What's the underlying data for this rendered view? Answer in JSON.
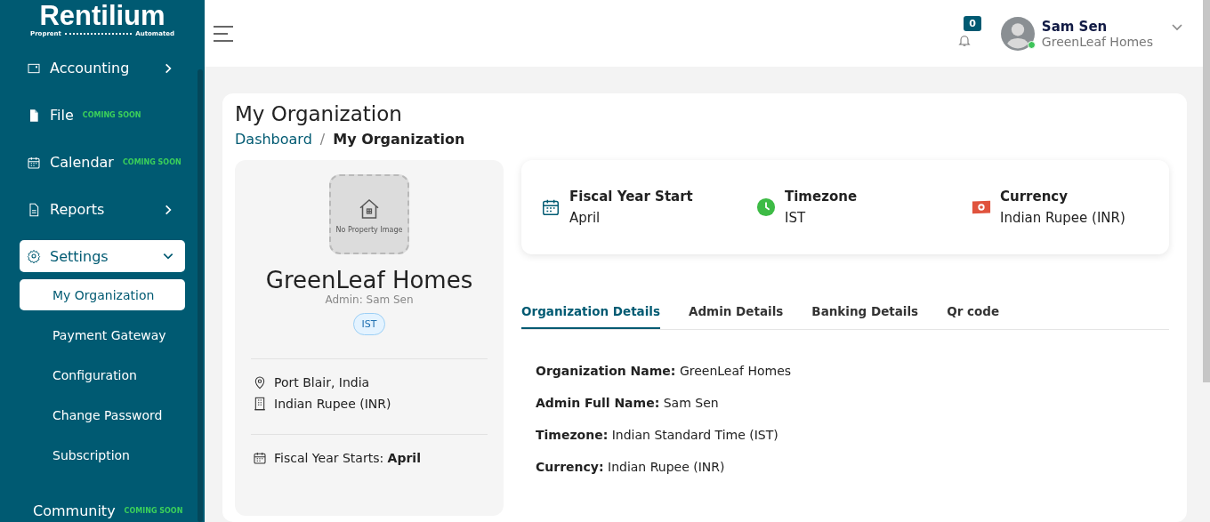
{
  "logo": {
    "name": "Rentilium",
    "tagline_left": "Proprent",
    "tagline_right": "Automated"
  },
  "sidebar": {
    "items": [
      {
        "label": "Accounting",
        "expanded": false
      },
      {
        "label": "File",
        "badge": "COMING SOON"
      },
      {
        "label": "Calendar",
        "badge": "COMING SOON"
      },
      {
        "label": "Reports",
        "expanded": false
      },
      {
        "label": "Settings",
        "expanded": true,
        "children": [
          {
            "label": "My Organization",
            "selected": true
          },
          {
            "label": "Payment Gateway",
            "selected": false
          },
          {
            "label": "Configuration",
            "selected": false
          },
          {
            "label": "Change Password",
            "selected": false
          },
          {
            "label": "Subscription",
            "selected": false
          }
        ]
      },
      {
        "label": "Community",
        "badge": "COMING SOON"
      }
    ]
  },
  "header": {
    "notifications": "0",
    "user": {
      "name": "Sam Sen",
      "org": "GreenLeaf Homes",
      "online": true
    }
  },
  "page": {
    "title": "My Organization",
    "breadcrumb": {
      "items": [
        "Dashboard",
        "My Organization"
      ],
      "separator": "/"
    }
  },
  "profile": {
    "image_text": "No Property Image",
    "name": "GreenLeaf Homes",
    "admin": "Admin: Sam Sen",
    "tag": "IST",
    "groups": [
      [
        "Port Blair, India",
        "Indian Rupee (INR)"
      ],
      [
        "Fiscal Year Starts: **April**"
      ]
    ]
  },
  "summary": [
    {
      "label": "Fiscal Year Start",
      "value": "April"
    },
    {
      "label": "Timezone",
      "value": "IST"
    },
    {
      "label": "Currency",
      "value": "Indian Rupee (INR)"
    }
  ],
  "tabs": [
    {
      "label": "Organization Details",
      "selected": true
    },
    {
      "label": "Admin Details",
      "selected": false
    },
    {
      "label": "Banking Details",
      "selected": false
    },
    {
      "label": "Qr code",
      "selected": false
    }
  ],
  "details": [
    "**Organization Name:** GreenLeaf Homes",
    "**Admin Full Name:** Sam Sen",
    "**Timezone:** Indian Standard Time (IST)",
    "**Currency:** Indian Rupee (INR)"
  ]
}
